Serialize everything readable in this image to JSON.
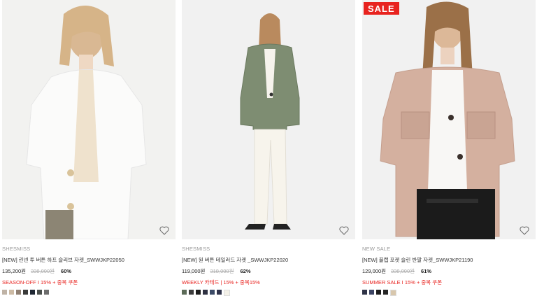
{
  "products": [
    {
      "badge": "",
      "brand": "SHESMISS",
      "name": "[NEW] 린넨 투 버튼 하프 슬리브 자켓_SWWJKP22050",
      "price": "135,200원",
      "original_price": "338,000원",
      "discount": "60%",
      "promo": "SEASON-OFF I 15% + 중복 쿠폰",
      "swatches": [
        "#bfb3a6",
        "#cdbba5",
        "#8f7f72",
        "#3a3a3a",
        "#1f2733",
        "#4a4f4c",
        "#6d6d6d"
      ]
    },
    {
      "badge": "",
      "brand": "SHESMISS",
      "name": "[NEW] 원 버튼 테일러드 자켓 _SWWJKP22020",
      "price": "119,000원",
      "original_price": "318,000원",
      "discount": "62%",
      "promo": "WEEKLY 카테드 | 15% + 중복15%",
      "swatches": [
        "#5c6b58",
        "#3c3c3c",
        "#1c1c1c",
        "#2e3142",
        "#3b4a66",
        "#30334a",
        "#f4f1e8"
      ]
    },
    {
      "badge": "SALE",
      "brand": "NEW SALE",
      "name": "[NEW] 플랩 포켓 슬린 반팔 자켓_SWWJKP21190",
      "price": "129,000원",
      "original_price": "338,000원",
      "discount": "61%",
      "promo": "SUMMER SALE I 15% + 중복 쿠폰",
      "swatches": [
        "#2f3447",
        "#3c4463",
        "#1c1c1c",
        "#262626",
        "#d8c7ad"
      ]
    }
  ],
  "colors": {
    "accent": "#e8231f"
  },
  "icons": {
    "wishlist": "heart-icon"
  }
}
